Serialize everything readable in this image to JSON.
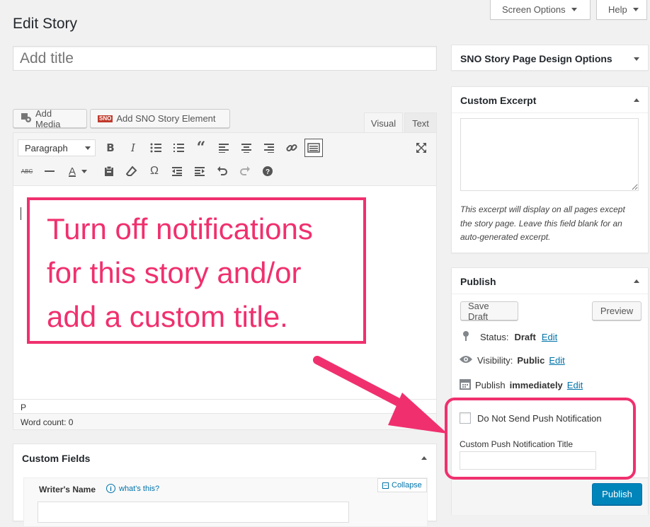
{
  "header": {
    "screen_options_label": "Screen Options",
    "help_label": "Help",
    "page_title": "Edit Story"
  },
  "title_input": {
    "placeholder": "Add title",
    "value": ""
  },
  "editor": {
    "add_media_label": "Add Media",
    "add_sno_label": "Add SNO Story Element",
    "sno_logo_text": "SNO",
    "tab_visual": "Visual",
    "tab_text": "Text",
    "format_select": "Paragraph",
    "toolbar_row1": [
      "bold-icon",
      "italic-icon",
      "bulleted-list-icon",
      "numbered-list-icon",
      "blockquote-icon",
      "align-left-icon",
      "align-center-icon",
      "align-right-icon",
      "link-icon",
      "toolbar-toggle-icon",
      "fullscreen-icon"
    ],
    "toolbar_row2": [
      "strikethrough-icon",
      "horizontal-line-icon",
      "text-color-icon",
      "paste-text-icon",
      "clear-formatting-icon",
      "special-character-icon",
      "outdent-icon",
      "indent-icon",
      "undo-icon",
      "redo-icon",
      "help-icon"
    ],
    "path_label": "P",
    "word_count_label": "Word count: 0"
  },
  "annotation": {
    "lines": [
      "Turn off notifications",
      "for this story and/or",
      "add a custom title."
    ],
    "color": "#f0306e"
  },
  "custom_fields": {
    "title": "Custom Fields",
    "writer_label": "Writer's Name",
    "whats_this": "what's this?",
    "collapse_label": "Collapse"
  },
  "sidebar": {
    "design_options_title": "SNO Story Page Design Options",
    "custom_excerpt": {
      "title": "Custom Excerpt",
      "help_text": "This excerpt will display on all pages except the story page. Leave this field blank for an auto-generated excerpt."
    },
    "publish": {
      "title": "Publish",
      "save_draft_label": "Save Draft",
      "preview_label": "Preview",
      "status_label": "Status:",
      "status_value": "Draft",
      "visibility_label": "Visibility:",
      "visibility_value": "Public",
      "publish_label": "Publish",
      "publish_value": "immediately",
      "edit_label": "Edit",
      "push_checkbox_label": "Do Not Send Push Notification",
      "push_checkbox_checked": false,
      "push_title_label": "Custom Push Notification Title",
      "push_title_value": "",
      "publish_button_label": "Publish"
    }
  },
  "colors": {
    "accent": "#0085ba",
    "link": "#0073aa",
    "highlight": "#f0306e"
  }
}
